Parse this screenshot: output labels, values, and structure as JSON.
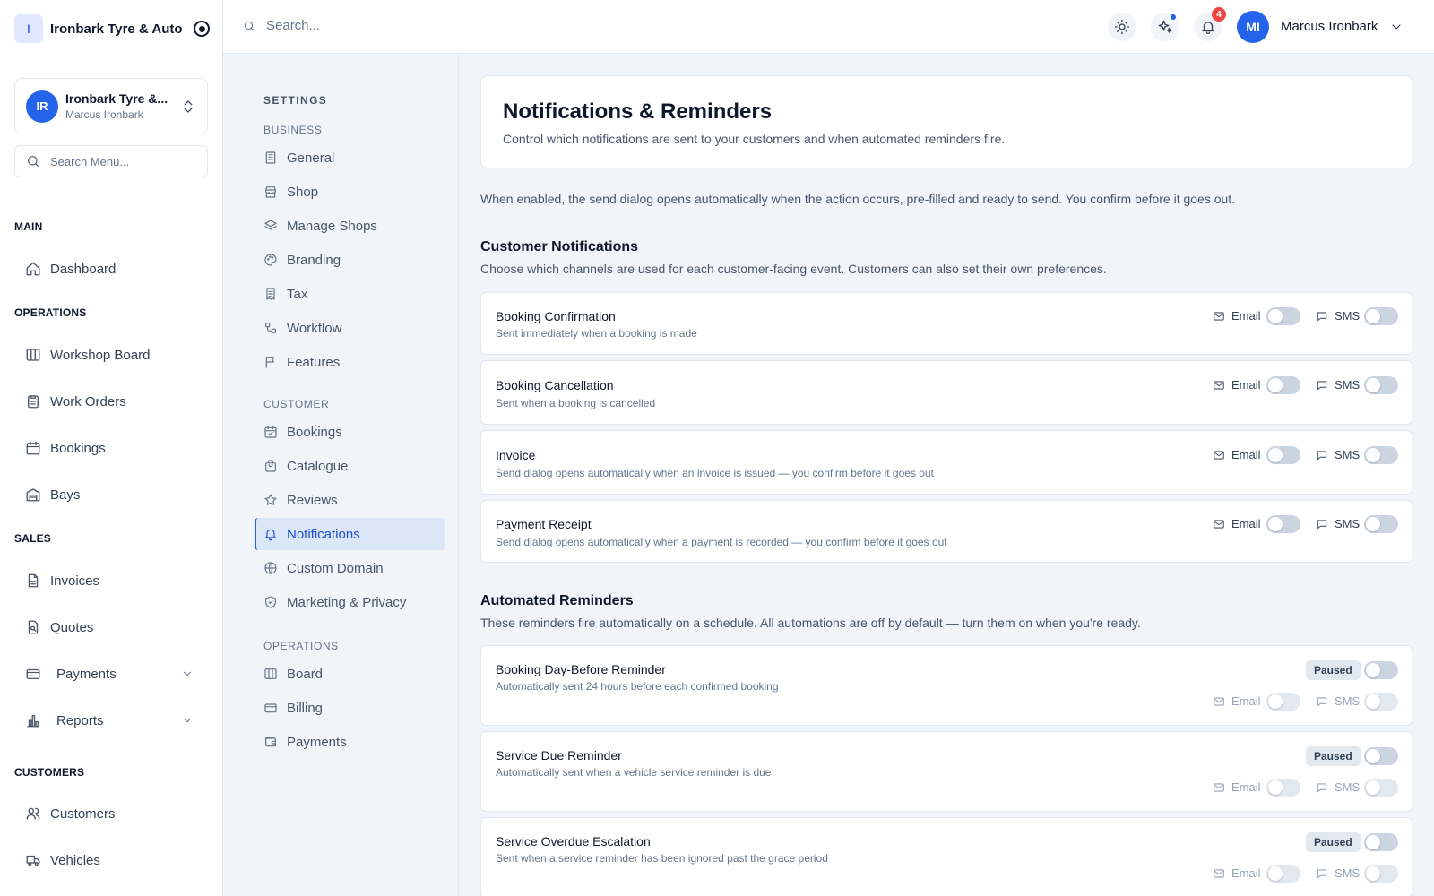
{
  "brand": {
    "logo_letter": "I",
    "name": "Ironbark Tyre & Auto"
  },
  "shop_switcher": {
    "initials": "IR",
    "name": "Ironbark Tyre &...",
    "owner": "Marcus Ironbark"
  },
  "sidebar": {
    "search_placeholder": "Search Menu...",
    "sections": {
      "main": "MAIN",
      "operations": "OPERATIONS",
      "sales": "SALES",
      "customers": "CUSTOMERS"
    },
    "items": {
      "dashboard": "Dashboard",
      "workshop_board": "Workshop Board",
      "work_orders": "Work Orders",
      "bookings": "Bookings",
      "bays": "Bays",
      "invoices": "Invoices",
      "quotes": "Quotes",
      "payments": "Payments",
      "reports": "Reports",
      "customers": "Customers",
      "vehicles": "Vehicles"
    }
  },
  "topbar": {
    "search_placeholder": "Search...",
    "notification_count": "4",
    "user_initials": "MI",
    "user_name": "Marcus Ironbark"
  },
  "settings_nav": {
    "title": "SETTINGS",
    "sections": {
      "business": "BUSINESS",
      "customer": "CUSTOMER",
      "operations": "OPERATIONS"
    },
    "items": {
      "general": "General",
      "shop": "Shop",
      "manage_shops": "Manage Shops",
      "branding": "Branding",
      "tax": "Tax",
      "workflow": "Workflow",
      "features": "Features",
      "bookings": "Bookings",
      "catalogue": "Catalogue",
      "reviews": "Reviews",
      "notifications": "Notifications",
      "custom_domain": "Custom Domain",
      "marketing_privacy": "Marketing & Privacy",
      "board": "Board",
      "billing": "Billing",
      "payments": "Payments"
    }
  },
  "page": {
    "title": "Notifications & Reminders",
    "subtitle": "Control which notifications are sent to your customers and when automated reminders fire.",
    "intro": "When enabled, the send dialog opens automatically when the action occurs, pre-filled and ready to send. You confirm before it goes out."
  },
  "channels": {
    "email": "Email",
    "sms": "SMS"
  },
  "customer_notifications": {
    "title": "Customer Notifications",
    "description": "Choose which channels are used for each customer-facing event. Customers can also set their own preferences.",
    "items": [
      {
        "title": "Booking Confirmation",
        "description": "Sent immediately when a booking is made",
        "email_enabled": false,
        "sms_enabled": false
      },
      {
        "title": "Booking Cancellation",
        "description": "Sent when a booking is cancelled",
        "email_enabled": false,
        "sms_enabled": false
      },
      {
        "title": "Invoice",
        "description": "Send dialog opens automatically when an invoice is issued — you confirm before it goes out",
        "email_enabled": false,
        "sms_enabled": false
      },
      {
        "title": "Payment Receipt",
        "description": "Send dialog opens automatically when a payment is recorded — you confirm before it goes out",
        "email_enabled": false,
        "sms_enabled": false
      }
    ]
  },
  "automated_reminders": {
    "title": "Automated Reminders",
    "description": "These reminders fire automatically on a schedule. All automations are off by default — turn them on when you're ready.",
    "status_label": "Paused",
    "items": [
      {
        "title": "Booking Day-Before Reminder",
        "description": "Automatically sent 24 hours before each confirmed booking",
        "enabled": false
      },
      {
        "title": "Service Due Reminder",
        "description": "Automatically sent when a vehicle service reminder is due",
        "enabled": false
      },
      {
        "title": "Service Overdue Escalation",
        "description": "Sent when a service reminder has been ignored past the grace period",
        "enabled": false
      }
    ]
  }
}
